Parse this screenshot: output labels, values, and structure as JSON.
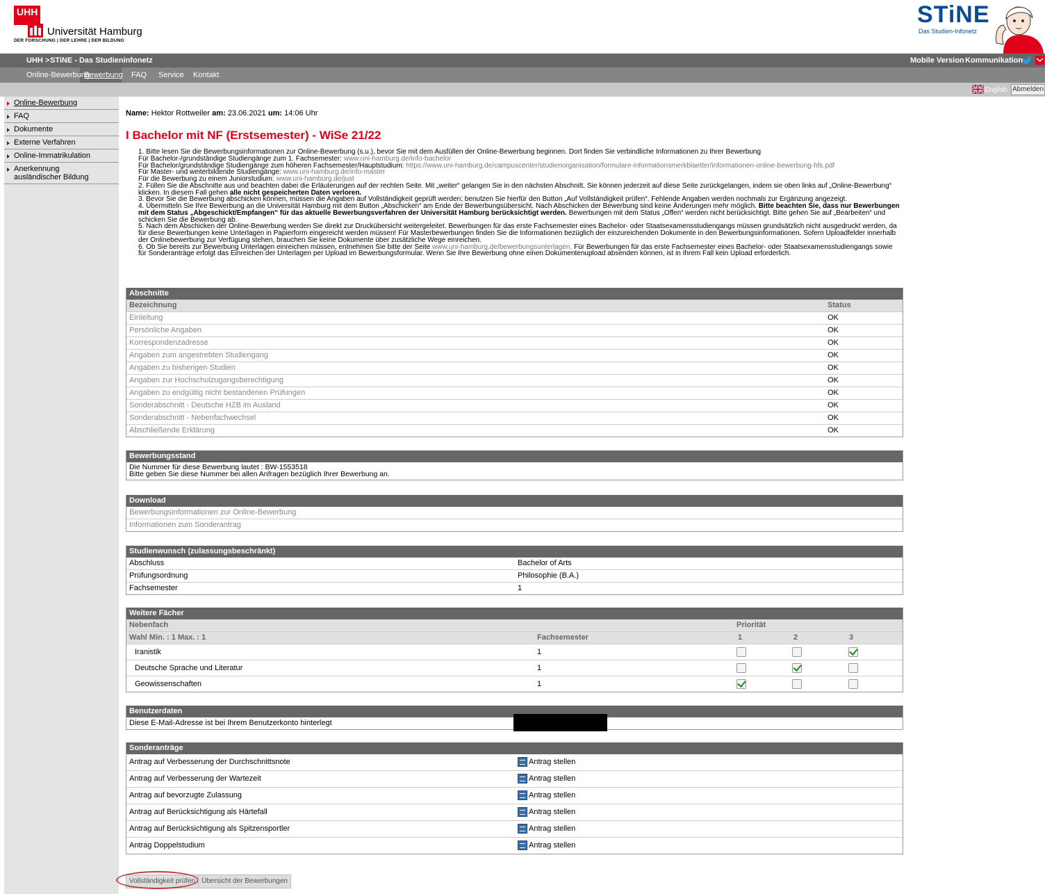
{
  "header": {
    "uhh_box": "UHH",
    "uhh_name": "Universität Hamburg",
    "uhh_sub": "DER FORSCHUNG | DER LEHRE | DER BILDUNG",
    "stine_word": "STiNE",
    "stine_sub": "Das Studien-Infonetz"
  },
  "topbar": {
    "uhh": "UHH >",
    "stine": "STiNE - Das Studieninfonetz",
    "mobile": "Mobile Version",
    "kommunikation": "Kommunikation"
  },
  "nav": {
    "items": [
      "Online-Bewerbung",
      "Bewerbung",
      "FAQ",
      "Service",
      "Kontakt"
    ],
    "active": "Bewerbung"
  },
  "subbar": {
    "english": "English",
    "logout": "Abmelden"
  },
  "leftnav": {
    "items": [
      "Online-Bewerbung",
      "FAQ",
      "Dokumente",
      "Externe Verfahren",
      "Online-Immatrikulation",
      "Anerkennung ausländischer Bildung"
    ]
  },
  "user": {
    "name_label": "Name:",
    "name": "Hektor Rottweiler",
    "date_label": "am:",
    "date": "23.06.2021",
    "time_label": "um:",
    "time": "14:06 Uhr"
  },
  "page_title": "I Bachelor mit NF (Erstsemester) - WiSe 21/22",
  "instructions": {
    "p1": "1. Bitte lesen Sie die Bewerbungsinformationen zur Online-Bewerbung (s.u.), bevor Sie mit dem Ausfüllen der Online-Bewerbung beginnen. Dort finden Sie verbindliche Informationen zu Ihrer Bewerbung",
    "p1a_label": "Für Bachelor-/grundständige Studiengänge zum 1. Fachsemester:",
    "p1a_link": "www.uni-hamburg.de/info-bachelor",
    "p1b_label": "Für Bachelor/grundständige Studiengänge zum höheren Fachsemester/Hauptstudium:",
    "p1b_link": "https://www.uni-hamburg.de/campuscenter/studienorganisation/formulare-informationsmerkblaetter/informationen-online-bewerbung-hfs.pdf",
    "p1c_label": "Für Master- und weiterbildende Studiengänge:",
    "p1c_link": "www.uni-hamburg.de/info-master",
    "p1d_label": "Für die Bewerbung zu einem Juniorstudium:",
    "p1d_link": "www.uni-hamburg.de/just",
    "p2": "2. Füllen Sie die Abschnitte aus und beachten dabei die Erläuterungen auf der rechten Seite. Mit „weiter“ gelangen Sie in den nächsten Abschnitt. Sie können jederzeit auf diese Seite zurückgelangen, indem sie oben links auf „Online-Bewerbung“ klicken. In diesem Fall gehen",
    "p2_bold": "alle nicht gespeicherten Daten verloren.",
    "p3": "3. Bevor Sie die Bewerbung abschicken können, müssen die Angaben auf Vollständigkeit geprüft werden; benutzen Sie hierfür den Button „Auf Vollständigkeit prüfen“. Fehlende Angaben werden nochmals zur Ergänzung angezeigt.",
    "p4": "4. Übermitteln Sie Ihre Bewerbung an die Universität Hamburg mit dem Button „Abschicken“ am Ende der Bewerbungsübersicht. Nach Abschicken der Bewerbung sind keine Änderungen mehr möglich.",
    "p4_bold": "Bitte beachten Sie, dass nur Bewerbungen mit dem Status „Abgeschickt/Empfangen“ für das aktuelle Bewerbungsverfahren der Universität Hamburg berücksichtigt werden.",
    "p4_rest": "Bewerbungen mit dem Status „Offen“ werden nicht berücksichtigt. Bitte gehen Sie auf „Bearbeiten“ und schicken Sie die Bewerbung ab.",
    "p5": "5. Nach dem Abschicken der Online-Bewerbung werden Sie direkt zur Druckübersicht weitergeleitet. Bewerbungen für das erste Fachsemester eines Bachelor- oder Staatsexamensstudiengangs müssen grundsätzlich nicht ausgedruckt werden, da für diese Bewerbungen keine Unterlagen in Papierform eingereicht werden müssen! Für Masterbewerbungen finden Sie die Informationen bezüglich der einzureichenden Dokumente in den Bewerbungsinformationen. Sofern Uploadfelder innerhalb der Onlinebewerbung zur Verfügung stehen, brauchen Sie keine Dokumente über zusätzliche Wege einreichen.",
    "p6a": "6. Ob Sie bereits zur Bewerbung Unterlagen einreichen müssen, entnehmen Sie bitte der Seite",
    "p6_link": "www.uni-hamburg.de/bewerbungsunterlagen.",
    "p6b": "Für Bewerbungen für das erste Fachsemester eines Bachelor- oder Staatsexamensstudiengangs sowie für Sonderanträge erfolgt das Einreichen der Unterlagen per Upload im Bewerbungsformular. Wenn Sie Ihre Bewerbung ohne einen Dokumentenupload absenden können, ist in Ihrem Fall kein Upload erforderlich."
  },
  "abschnitte": {
    "title": "Abschnitte",
    "col_name": "Bezeichnung",
    "col_status": "Status",
    "rows": [
      {
        "name": "Einleitung",
        "status": "OK"
      },
      {
        "name": "Persönliche Angaben",
        "status": "OK"
      },
      {
        "name": "Korrespondenzadresse",
        "status": "OK"
      },
      {
        "name": "Angaben zum angestrebten Studiengang",
        "status": "OK"
      },
      {
        "name": "Angaben zu bisherigen Studien",
        "status": "OK"
      },
      {
        "name": "Angaben zur Hochschulzugangsberechtigung",
        "status": "OK"
      },
      {
        "name": "Angaben zu endgültig nicht bestandenen Prüfungen",
        "status": "OK"
      },
      {
        "name": "Sonderabschnitt - Deutsche HZB im Ausland",
        "status": "OK"
      },
      {
        "name": "Sonderabschnitt - Nebenfachwechsel",
        "status": "OK"
      },
      {
        "name": "Abschließende Erklärung",
        "status": "OK"
      }
    ]
  },
  "bewerbungsstand": {
    "title": "Bewerbungsstand",
    "line1": "Die Nummer für diese Bewerbung lautet : BW-1553518",
    "line2": "Bitte geben Sie diese Nummer bei allen Anfragen bezüglich Ihrer Bewerbung an."
  },
  "download": {
    "title": "Download",
    "items": [
      "Bewerbungsinformationen zur Online-Bewerbung",
      "Informationen zum Sonderantrag"
    ]
  },
  "studienwunsch": {
    "title": "Studienwunsch (zulassungsbeschränkt)",
    "rows": [
      {
        "label": "Abschluss",
        "value": "Bachelor of Arts"
      },
      {
        "label": "Prüfungsordnung",
        "value": "Philosophie (B.A.)"
      },
      {
        "label": "Fachsemester",
        "value": "1"
      }
    ]
  },
  "weitere": {
    "title": "Weitere Fächer",
    "sub1": "Nebenfach",
    "prio": "Priorität",
    "wahl": "Wahl Min. : 1  Max. : 1",
    "col_fs": "Fachsemester",
    "prio_cols": [
      "1",
      "2",
      "3"
    ],
    "rows": [
      {
        "name": "Iranistik",
        "fs": "1",
        "checked": [
          false,
          false,
          true
        ]
      },
      {
        "name": "Deutsche Sprache und Literatur",
        "fs": "1",
        "checked": [
          false,
          true,
          false
        ]
      },
      {
        "name": "Geowissenschaften",
        "fs": "1",
        "checked": [
          true,
          false,
          false
        ]
      }
    ]
  },
  "benutzerdaten": {
    "title": "Benutzerdaten",
    "label": "Diese E-Mail-Adresse ist bei Ihrem Benutzerkonto hinterlegt"
  },
  "sonderantraege": {
    "title": "Sonderanträge",
    "action": "Antrag stellen",
    "rows": [
      "Antrag auf Verbesserung der Durchschnittsnote",
      "Antrag auf Verbesserung der Wartezeit",
      "Antrag auf bevorzugte Zulassung",
      "Antrag auf Berücksichtigung als Härtefall",
      "Antrag auf Berücksichtigung als Spitzensportler",
      "Antrag Doppelstudium"
    ]
  },
  "buttons": {
    "check": "Vollständigkeit prüfen",
    "overview": "Übersicht der Bewerbungen"
  }
}
